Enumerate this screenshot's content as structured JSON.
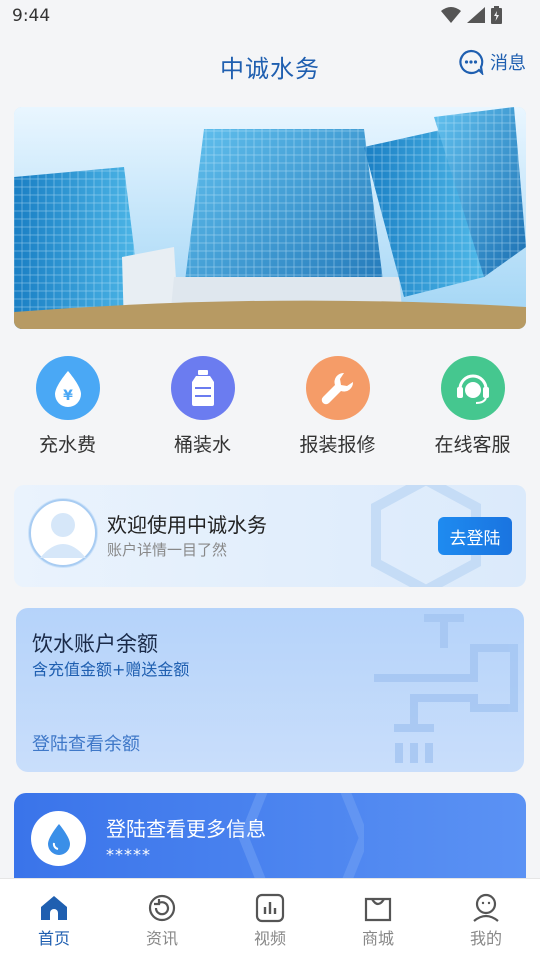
{
  "status_bar": {
    "time": "9:44",
    "icons": [
      "wifi-icon",
      "signal-icon",
      "battery-icon"
    ]
  },
  "header": {
    "title": "中诚水务",
    "message_label": "消息"
  },
  "services": [
    {
      "label": "充水费",
      "icon": "yen-drop-icon",
      "color": "#4aa8f5"
    },
    {
      "label": "桶装水",
      "icon": "water-bucket-icon",
      "color": "#6b7cf0"
    },
    {
      "label": "报装报修",
      "icon": "wrench-icon",
      "color": "#f59c68"
    },
    {
      "label": "在线客服",
      "icon": "headset-icon",
      "color": "#45c78f"
    }
  ],
  "welcome": {
    "title": "欢迎使用中诚水务",
    "subtitle": "账户详情一目了然",
    "login_label": "去登陆"
  },
  "balance": {
    "title": "饮水账户余额",
    "subtitle": "含充值金额+赠送金额",
    "link": "登陆查看余额"
  },
  "info": {
    "title": "登陆查看更多信息",
    "masked": "*****"
  },
  "tabs": [
    {
      "label": "首页",
      "icon": "home-icon",
      "active": true
    },
    {
      "label": "资讯",
      "icon": "refresh-icon",
      "active": false
    },
    {
      "label": "视频",
      "icon": "chart-icon",
      "active": false
    },
    {
      "label": "商城",
      "icon": "shopping-bag-icon",
      "active": false
    },
    {
      "label": "我的",
      "icon": "user-icon",
      "active": false
    }
  ],
  "colors": {
    "brand": "#1f5fb0",
    "accent": "#1e8bf0"
  }
}
